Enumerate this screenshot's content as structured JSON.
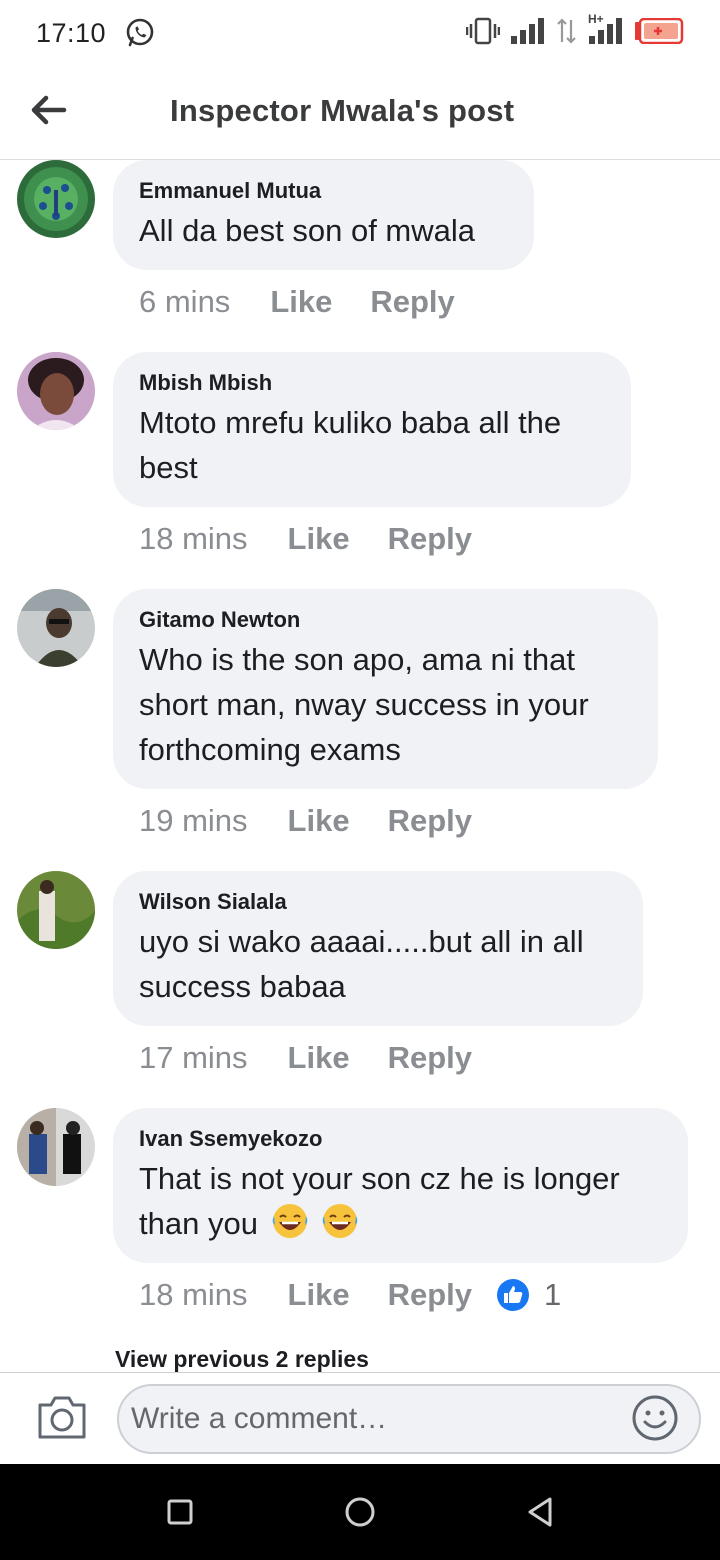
{
  "status_bar": {
    "time": "17:10",
    "icons": [
      "whatsapp-icon",
      "vibrate-icon",
      "signal-icon",
      "data-arrows-icon",
      "signal-hplus-icon",
      "battery-icon"
    ],
    "hplus_label": "H+"
  },
  "header": {
    "title": "Inspector Mwala's post",
    "back_icon": "arrow-left-icon"
  },
  "comments": [
    {
      "author": "Emmanuel Mutua",
      "text": "All da best son of mwala",
      "time": "6 mins",
      "like_label": "Like",
      "reply_label": "Reply"
    },
    {
      "author": "Mbish Mbish",
      "text_lines": [
        "Mtoto mrefu kuliko baba all the",
        "best"
      ],
      "time": "18 mins",
      "like_label": "Like",
      "reply_label": "Reply"
    },
    {
      "author": "Gitamo Newton",
      "text_lines": [
        "Who is the son apo, ama ni that",
        "short man, nway success in your",
        "forthcoming exams"
      ],
      "time": "19 mins",
      "like_label": "Like",
      "reply_label": "Reply"
    },
    {
      "author": "Wilson Sialala",
      "text_lines": [
        "uyo si wako aaaai.....but all in all",
        "success babaa"
      ],
      "time": "17 mins",
      "like_label": "Like",
      "reply_label": "Reply"
    },
    {
      "author": "Ivan Ssemyekozo",
      "text_lines": [
        "That is not your son cz he is longer",
        "than you"
      ],
      "emojis": [
        "tears-of-joy-emoji",
        "tears-of-joy-emoji"
      ],
      "time": "18 mins",
      "like_label": "Like",
      "reply_label": "Reply",
      "reaction_count": "1",
      "reaction_icon": "thumbs-up-icon"
    }
  ],
  "view_previous_replies": "View previous 2 replies",
  "composer": {
    "placeholder": "Write a comment…",
    "camera_icon": "camera-icon",
    "emoji_icon": "smiley-icon"
  },
  "nav_bar": {
    "icons": [
      "recent-apps-icon",
      "home-icon",
      "back-icon"
    ]
  },
  "colors": {
    "bubble": "#f0f2f5",
    "meta_text": "#8a8d91",
    "reaction_blue": "#1877f2"
  }
}
